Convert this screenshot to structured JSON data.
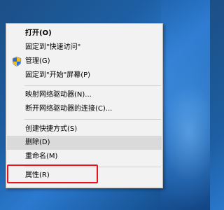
{
  "context_menu": {
    "items": [
      {
        "label": "打开(O)"
      },
      {
        "label": "固定到\"快速访问\""
      },
      {
        "label": "管理(G)"
      },
      {
        "label": "固定到\"开始\"屏幕(P)"
      },
      {
        "label": "映射网络驱动器(N)..."
      },
      {
        "label": "断开网络驱动器的连接(C)..."
      },
      {
        "label": "创建快捷方式(S)"
      },
      {
        "label": "删除(D)"
      },
      {
        "label": "重命名(M)"
      },
      {
        "label": "属性(R)"
      }
    ]
  },
  "icons": {
    "manage": "uac-shield-icon"
  },
  "colors": {
    "menu_background": "#f2f2f2",
    "hover_background": "#dadada",
    "highlight_border": "#e8141e",
    "desktop_blue": "#1d5fa3"
  }
}
